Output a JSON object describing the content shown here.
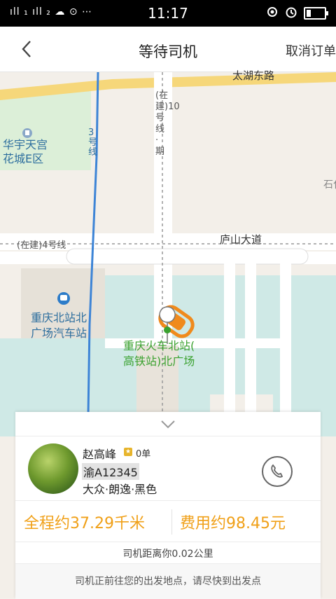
{
  "status": {
    "left_icons": "ıll ₁ ıll ₂ ☁ ⊙ ⋯",
    "time": "11:17"
  },
  "nav": {
    "title": "等待司机",
    "cancel_label": "取消订单"
  },
  "map": {
    "road_top": "太湖东路",
    "metro_line3": "3号线",
    "metro_line10": "(在建)10号线·期",
    "metro_line4": "(在建)4号线",
    "road_lushan": "庐山大道",
    "poi_garden": [
      "华宇天宫",
      "花城E区"
    ],
    "poi_bus": [
      "重庆北站北",
      "广场汽车站"
    ],
    "poi_station": [
      "重庆火车北站(",
      "高铁站)北广场"
    ],
    "edge_label": "石化"
  },
  "driver": {
    "name": "赵高峰",
    "orders": "0单",
    "plate": "渝A12345",
    "car": "大众·朗逸·黑色"
  },
  "trip": {
    "distance_text": "全程约37.29千米",
    "fare_text": "费用约98.45元",
    "driver_distance_note": "司机距离你0.02公里",
    "notice": "司机正前往您的出发地点，请尽快到出发点"
  },
  "colors": {
    "accent": "#f0a018",
    "metro": "#3d84d6",
    "green_area": "#dcefd8",
    "water": "#cfe9e6"
  }
}
